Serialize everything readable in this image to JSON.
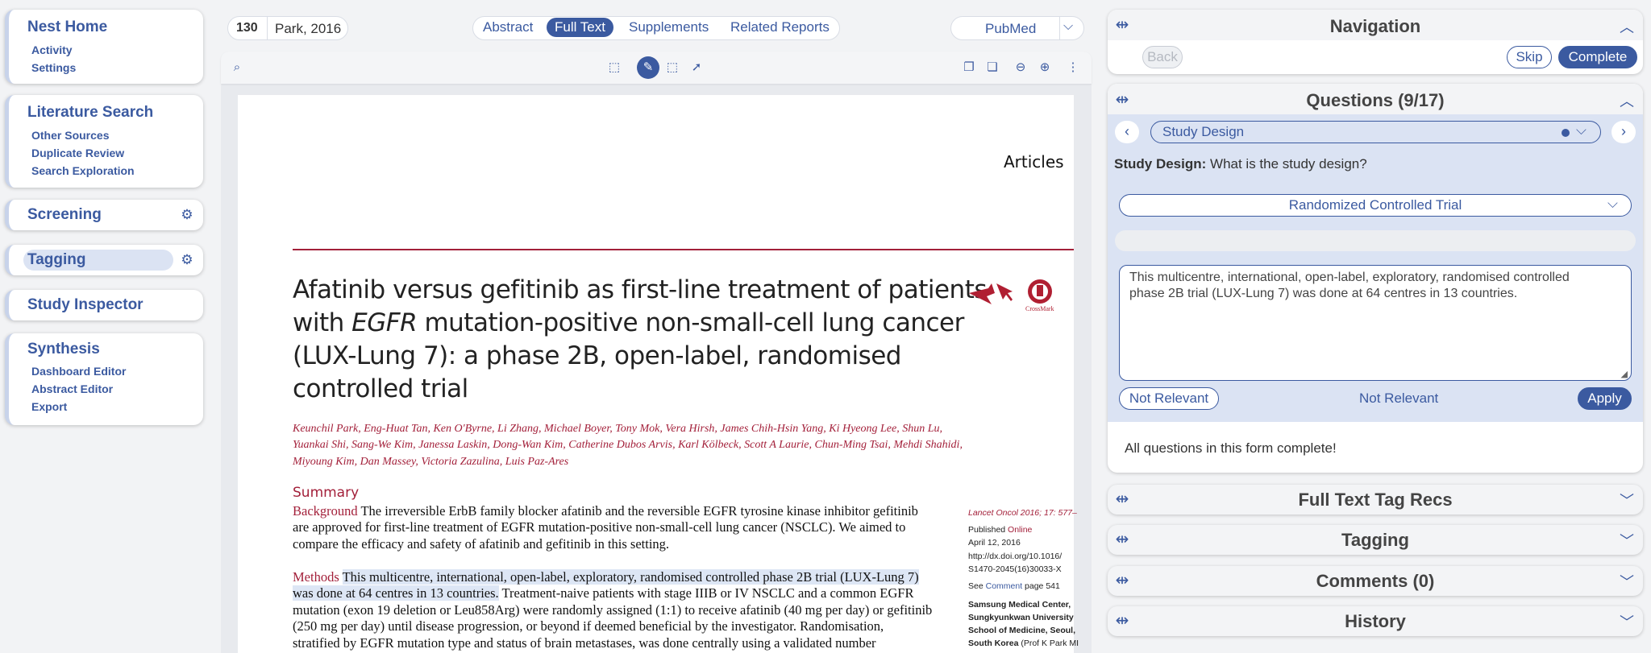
{
  "sidebar": {
    "nest_home": {
      "title": "Nest Home",
      "items": [
        "Activity",
        "Settings"
      ]
    },
    "literature_search": {
      "title": "Literature Search",
      "items": [
        "Other Sources",
        "Duplicate Review",
        "Search Exploration"
      ]
    },
    "screening": {
      "title": "Screening"
    },
    "tagging": {
      "title": "Tagging"
    },
    "study_inspector": {
      "title": "Study Inspector"
    },
    "synthesis": {
      "title": "Synthesis",
      "items": [
        "Dashboard Editor",
        "Abstract Editor",
        "Export"
      ]
    }
  },
  "topbar": {
    "record_id": "130",
    "record_label": "Park, 2016",
    "tabs": [
      "Abstract",
      "Full Text",
      "Supplements",
      "Related Reports"
    ],
    "active_tab": "Full Text",
    "source_select": "PubMed"
  },
  "paper": {
    "section_label": "Articles",
    "title_lines": [
      "Afatinib versus gefitinib as first-line treatment of patients",
      [
        "with ",
        "EGFR",
        " mutation-positive non-small-cell lung cancer"
      ],
      "(LUX-Lung 7): a phase 2B, open-label, randomised",
      "controlled trial"
    ],
    "crossmark": "CrossMark",
    "authors": [
      "Keunchil Park, Eng-Huat Tan, Ken O'Byrne, Li Zhang, Michael Boyer, Tony Mok, Vera Hirsh, James Chih-Hsin Yang, Ki Hyeong Lee, Shun Lu,",
      "Yuankai Shi, Sang-We Kim, Janessa Laskin, Dong-Wan Kim, Catherine Dubos Arvis, Karl Kölbeck, Scott A Laurie, Chun-Ming Tsai, Mehdi Shahidi,",
      "Miyoung Kim, Dan Massey, Victoria Zazulina, Luis Paz-Ares"
    ],
    "summary_heading": "Summary",
    "background_label": "Background",
    "background_lines": [
      " The irreversible ErbB family blocker afatinib and the reversible EGFR tyrosine kinase inhibitor gefitinib",
      "are approved for first-line treatment of EGFR mutation-positive non-small-cell lung cancer (NSCLC). We aimed to",
      "compare the efficacy and safety of afatinib and gefitinib in this setting."
    ],
    "methods_label": "Methods",
    "methods_highlight_1": "This multicentre, international, open-label, exploratory, randomised controlled phase 2B trial (LUX-Lung 7)",
    "methods_highlight_2": "was done at 64 centres in 13 countries.",
    "methods_rest_2": " Treatment-naive patients with stage IIIB or IV NSCLC and a common EGFR",
    "methods_lines": [
      "mutation (exon 19 deletion or Leu858Arg) were randomly assigned (1:1) to receive afatinib (40 mg per day) or gefitinib",
      "(250 mg per day) until disease progression, or beyond if deemed beneficial by the investigator. Randomisation,",
      "stratified by EGFR mutation type and status of brain metastases, was done centrally using a validated number"
    ],
    "side_notes": {
      "citation": "Lancet Oncol 2016; 17: 577–",
      "published": "Published Online",
      "published_prefix": "Published ",
      "published_link": "Online",
      "date": "April 12, 2016",
      "doi_1": "http://dx.doi.org/10.1016/",
      "doi_2": "S1470-2045(16)30033-X",
      "see_prefix": "See ",
      "see_link": "Comment",
      "see_suffix": " page 541",
      "affil_1": "Samsung Medical Center,",
      "affil_2": "Sungkyunkwan University",
      "affil_3": "School of Medicine, Seoul,",
      "affil_4": "South Korea",
      "affil_4_suffix": " (Prof K Park MI"
    }
  },
  "navigation": {
    "title": "Navigation",
    "back": "Back",
    "skip": "Skip",
    "complete": "Complete"
  },
  "questions": {
    "title": "Questions (9/17)",
    "current_question": "Study Design",
    "question_label": "Study Design:",
    "question_text": " What is the study design?",
    "answer_select": "Randomized Controlled Trial",
    "notes_text": "This multicentre, international, open-label, exploratory, randomised controlled\nphase 2B trial (LUX-Lung 7) was done at 64 centres in 13 countries.",
    "not_relevant_button": "Not Relevant",
    "not_relevant_status": "Not Relevant",
    "apply": "Apply",
    "complete_message": "All questions in this form complete!"
  },
  "collapsed_panels": [
    "Full Text Tag Recs",
    "Tagging",
    "Comments (0)",
    "History"
  ]
}
